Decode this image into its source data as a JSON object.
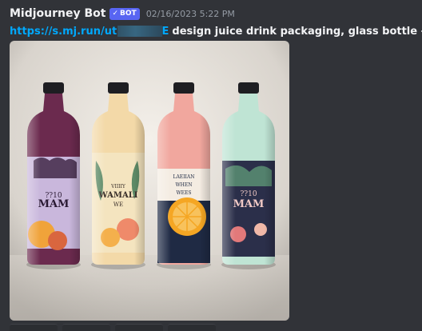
{
  "message": {
    "username": "Midjourney Bot",
    "badge": {
      "check": "✓",
      "label": "BOT"
    },
    "timestamp": "02/16/2023 5:22 PM",
    "link_text": "https://s.mj.run/ut",
    "link_tail": "E",
    "prompt_text": "design juice drink packaging, glass bottle -"
  },
  "image": {
    "bottles": [
      {
        "label_lines": [
          "??10",
          "MAM"
        ],
        "juice_color": "#6b2a4e",
        "label_color": "#c9b7dc"
      },
      {
        "label_lines": [
          "VIIIIY",
          "WAMALI",
          "WE"
        ],
        "juice_color": "#f3d9a8",
        "label_color": "#f4e4bf"
      },
      {
        "label_lines": [
          "LAEIIAN",
          "WHEN",
          "WEES"
        ],
        "juice_color": "#f1a79e",
        "label_color": "#1f2a44"
      },
      {
        "label_lines": [
          "??10",
          "MAM"
        ],
        "juice_color": "#bfe4d4",
        "label_color": "#2b2f4a"
      }
    ]
  },
  "colors": {
    "background": "#313338",
    "username": "#f2f3f5",
    "badge": "#5865f2",
    "timestamp": "#949ba4",
    "link": "#00a8fc"
  }
}
